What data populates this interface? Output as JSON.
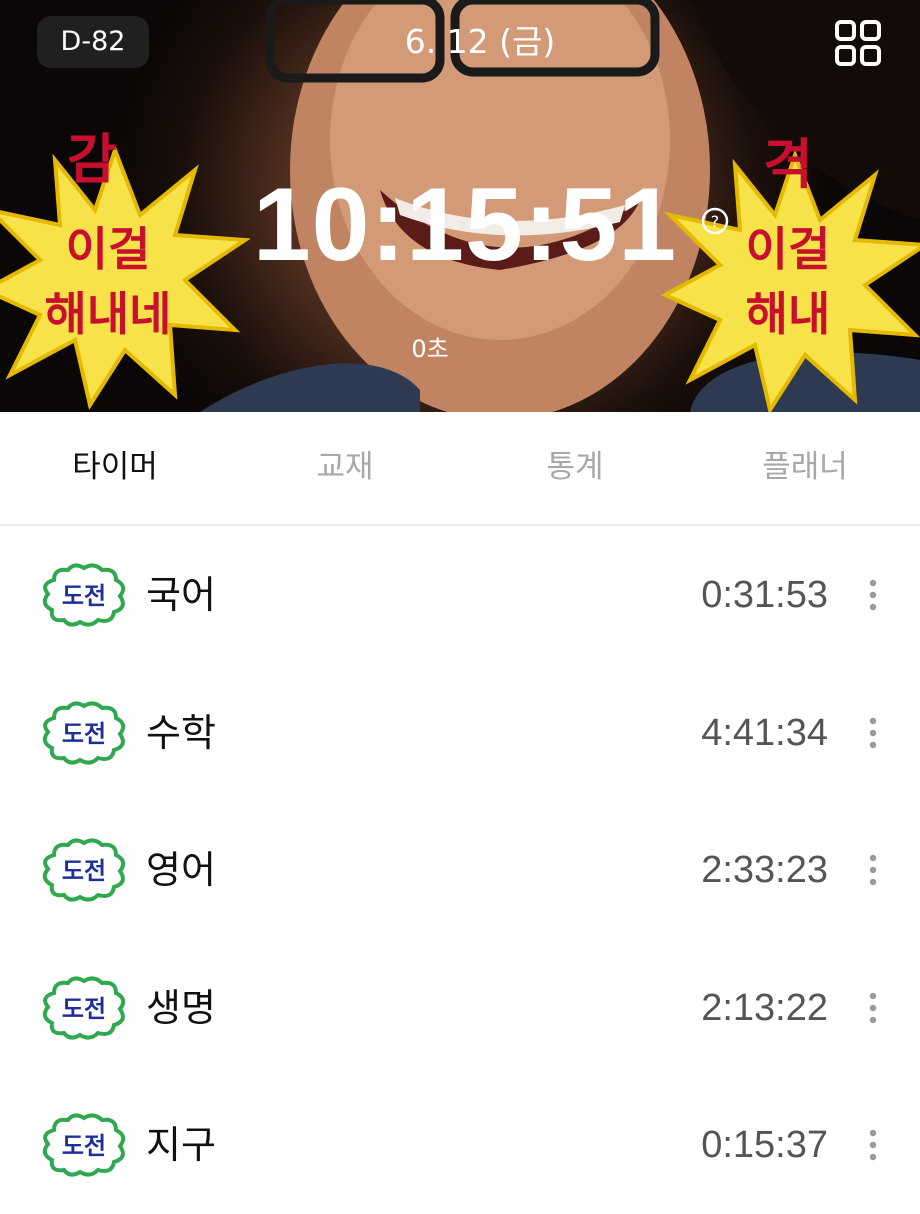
{
  "header": {
    "dday": "D-82",
    "date": "6. 12 (금)",
    "timer": "10:15:51",
    "seconds": "0초",
    "sticker_left": {
      "top": "감",
      "line1": "이걸",
      "line2": "해내네"
    },
    "sticker_right": {
      "top": "격",
      "line1": "이걸",
      "line2": "해내"
    }
  },
  "tabs": [
    {
      "label": "타이머",
      "active": true
    },
    {
      "label": "교재",
      "active": false
    },
    {
      "label": "통계",
      "active": false
    },
    {
      "label": "플래너",
      "active": false
    }
  ],
  "subjects": [
    {
      "badge": "도전",
      "name": "국어",
      "time": "0:31:53"
    },
    {
      "badge": "도전",
      "name": "수학",
      "time": "4:41:34"
    },
    {
      "badge": "도전",
      "name": "영어",
      "time": "2:33:23"
    },
    {
      "badge": "도전",
      "name": "생명",
      "time": "2:13:22"
    },
    {
      "badge": "도전",
      "name": "지구",
      "time": "0:15:37"
    }
  ],
  "colors": {
    "burst_yellow": "#f7e24a",
    "burst_text_red": "#c8102e",
    "badge_green": "#2fa84f",
    "badge_text_blue": "#1f2f9a",
    "time_gray": "#555555",
    "tab_inactive": "#a8a8a8"
  },
  "icons": {
    "grid": "grid-icon",
    "help": "help-circle-icon",
    "more": "more-vertical-icon"
  }
}
